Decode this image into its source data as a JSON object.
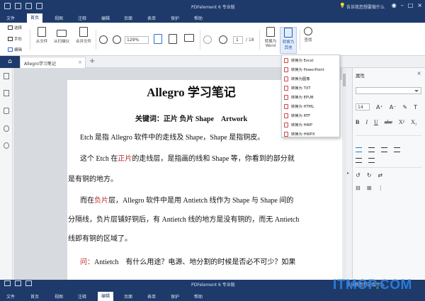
{
  "window": {
    "title": "PDFelement 6 专业版",
    "hint": "告诉我您想要做什么"
  },
  "menu": [
    "文件",
    "首页",
    "视图",
    "注释",
    "编辑",
    "页面",
    "表单",
    "保护",
    "帮助"
  ],
  "active_menu": "首页",
  "ribbon": {
    "select": "选择",
    "hand": "手形",
    "edit": "编辑",
    "from_file": "从文件",
    "from_scanner": "从扫描仪",
    "combine": "合并文件",
    "zoom_value": "129%",
    "page_current": "1",
    "page_total": "/ 18",
    "to_word_line1": "转换为",
    "to_word_line2": "Word",
    "to_other_line1": "转换为",
    "to_other_line2": "其他",
    "search": "查找"
  },
  "tabs": {
    "doc_tab": "Allegro学习笔记",
    "add": "+"
  },
  "convert_menu": [
    "转换为 Excel",
    "转换为 PowerPoint",
    "转换为图像",
    "转换为 TXT",
    "转换为 EPUB",
    "转换为 HTML",
    "转换为 RTF",
    "转换为 HWP",
    "转换为 HWPX"
  ],
  "document": {
    "title": "Allegro 学习笔记",
    "keywords": "关键词：正片 负片 Shape　Artwork",
    "p1": "Etch 是指 Allegro 软件中的走线及 Shape，Shape 是指铜皮。",
    "p2_a": "这个 Etch 在",
    "p2_red": "正片",
    "p2_b": "的走线层，是指画的线和 Shape 等，你看到的部分就",
    "p3": "是有铜的地方。",
    "p4_a": "而在",
    "p4_red": "负片",
    "p4_b": "层，Allegro 软件中是用 Antietch 线作为 Shape 与 Shape 间的",
    "p5": "分隔线，负片层铺好铜后，有 Antietch 线的地方是没有铜的，而无 Antietch",
    "p6": "线即有铜的区域了。",
    "p7_red": "问：",
    "p7_b": "Antietch　有什么用途？电源、地分割的时候是否必不可少？如果"
  },
  "properties": {
    "header": "属性",
    "font_size": "14"
  },
  "status_menu": [
    "文件",
    "首页",
    "视图",
    "注释",
    "编辑",
    "页面",
    "表单",
    "保护",
    "帮助"
  ],
  "status_active": "编辑",
  "watermark": {
    "text1": "ITMOP",
    "dot": ".",
    "text2": "COM"
  }
}
